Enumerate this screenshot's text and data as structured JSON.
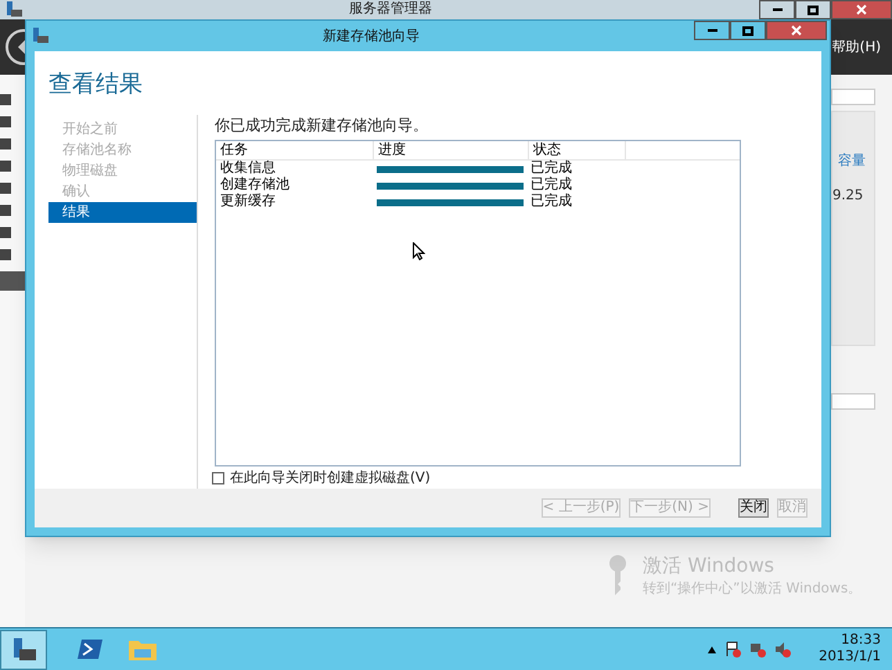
{
  "background_window": {
    "title": "服务器管理器",
    "menu_help": "帮助(H)",
    "column_header": "容量",
    "cell": "9.25"
  },
  "dialog": {
    "title": "新建存储池向导",
    "heading": "查看结果",
    "steps": [
      {
        "label": "开始之前",
        "selected": false
      },
      {
        "label": "存储池名称",
        "selected": false
      },
      {
        "label": "物理磁盘",
        "selected": false
      },
      {
        "label": "确认",
        "selected": false
      },
      {
        "label": "结果",
        "selected": true
      }
    ],
    "message": "你已成功完成新建存储池向导。",
    "table": {
      "columns": [
        "任务",
        "进度",
        "状态"
      ],
      "rows": [
        {
          "task": "收集信息",
          "level": 1,
          "status": "已完成"
        },
        {
          "task": "创建存储池",
          "level": 1,
          "status": "已完成"
        },
        {
          "task": "更新缓存",
          "level": 1,
          "status": "已完成"
        }
      ]
    },
    "checkbox": {
      "label": "在此向导关闭时创建虚拟磁盘(V)",
      "checked": false
    },
    "buttons": [
      {
        "label": "< 上一步(P)",
        "disabled": true
      },
      {
        "label": "下一步(N) >",
        "disabled": true
      },
      {
        "label": "关闭",
        "disabled": false
      },
      {
        "label": "取消",
        "disabled": true
      }
    ]
  },
  "activation": {
    "title": "激活 Windows",
    "text": "转到“操作中心”以激活 Windows。"
  },
  "taskbar": {
    "time": "18:33",
    "date": "2013/1/1"
  }
}
